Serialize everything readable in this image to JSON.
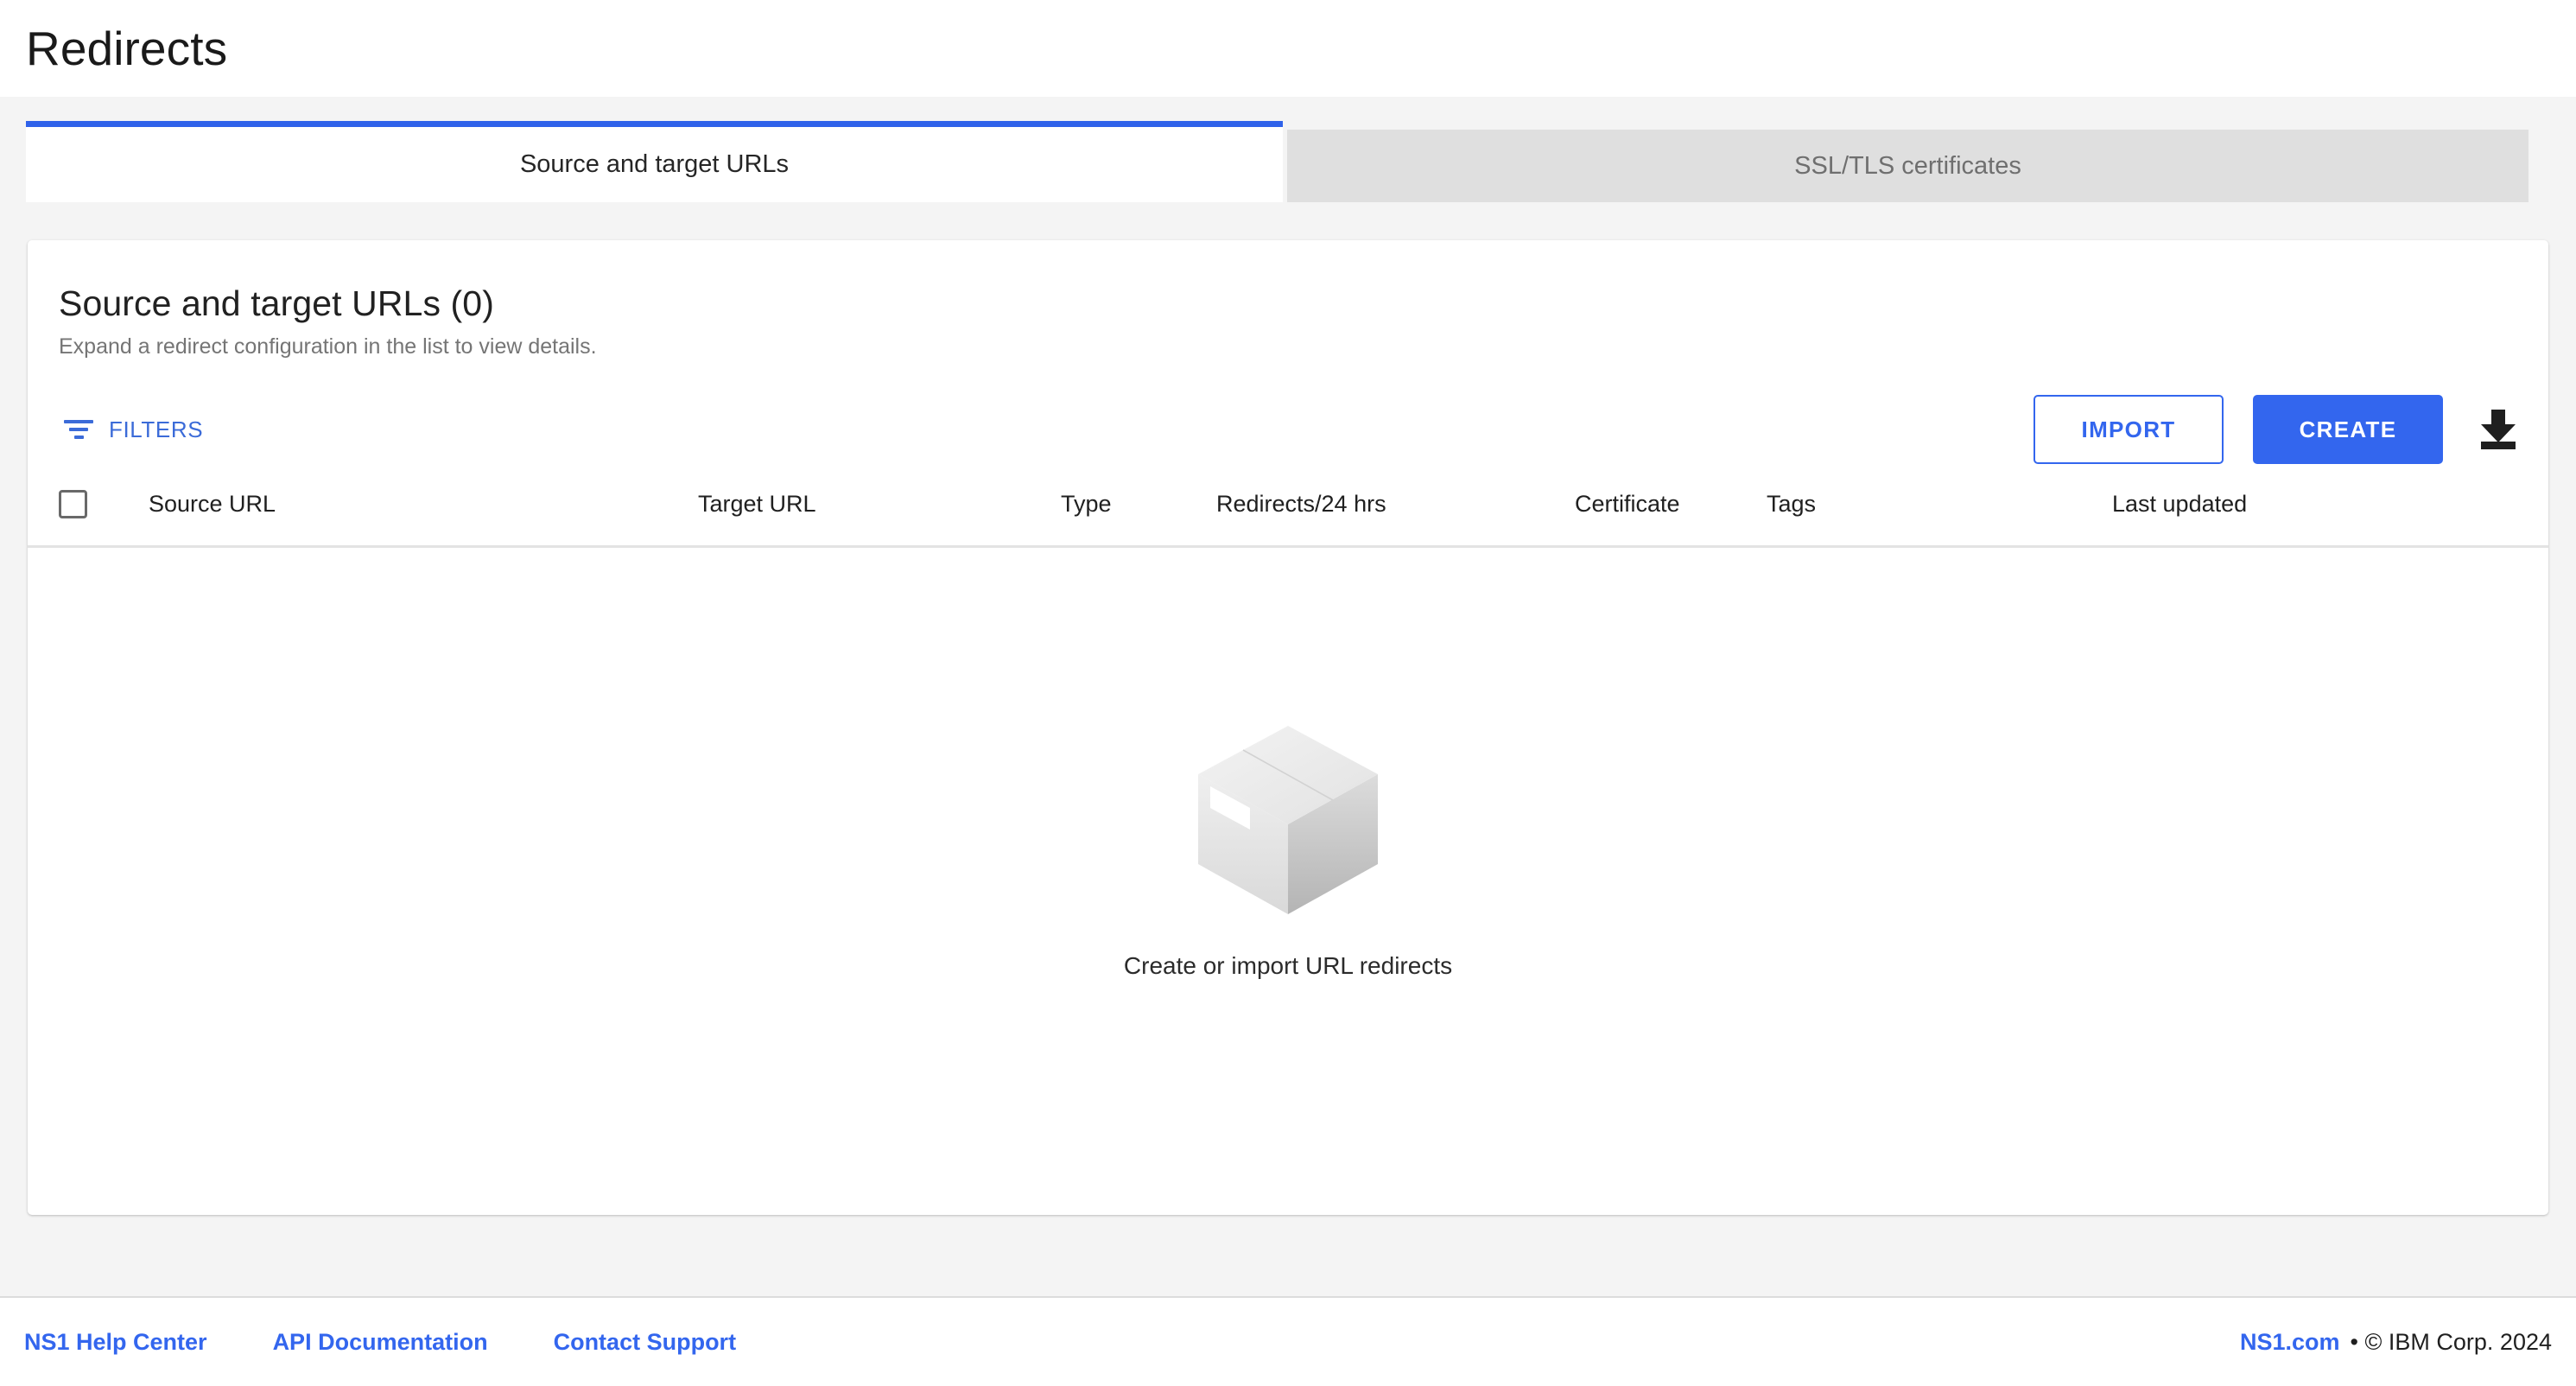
{
  "header": {
    "title": "Redirects"
  },
  "tabs": [
    {
      "label": "Source and target URLs",
      "active": true
    },
    {
      "label": "SSL/TLS certificates",
      "active": false
    }
  ],
  "card": {
    "title": "Source and target URLs (0)",
    "subtitle": "Expand a redirect configuration in the list to view details.",
    "count": 0
  },
  "toolbar": {
    "filters_label": "FILTERS",
    "filter_icon": "filter-icon",
    "import_label": "IMPORT",
    "create_label": "CREATE",
    "download_icon": "download-icon"
  },
  "table": {
    "select_all_checkbox": "unchecked",
    "columns": [
      "Source URL",
      "Target URL",
      "Type",
      "Redirects/24 hrs",
      "Certificate",
      "Tags",
      "Last updated"
    ],
    "rows": []
  },
  "empty_state": {
    "illustration": "box-illustration",
    "message": "Create or import URL redirects"
  },
  "footer": {
    "links": [
      "NS1 Help Center",
      "API Documentation",
      "Contact Support"
    ],
    "brand": "NS1.com",
    "copyright": "• © IBM Corp. 2024"
  },
  "colors": {
    "accent_blue": "#3366ee",
    "tab_active_border": "#2f62ea",
    "page_background": "#f4f4f4",
    "inactive_tab": "#dfdfdf"
  }
}
